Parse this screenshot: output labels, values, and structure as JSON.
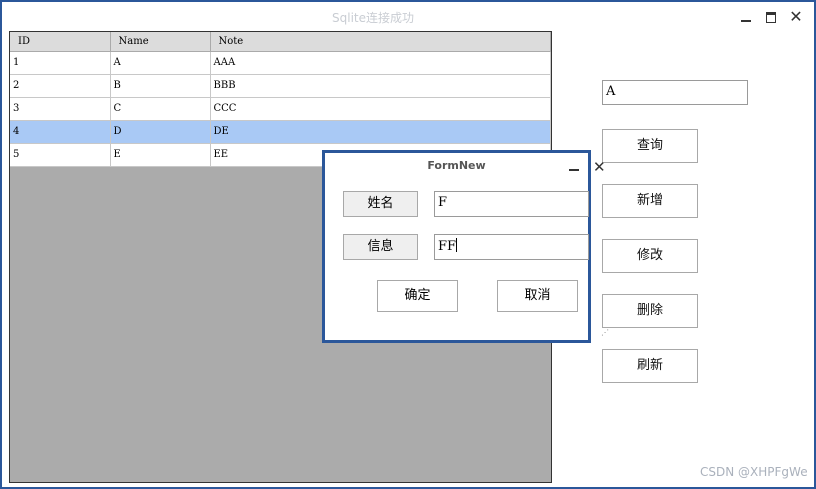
{
  "window": {
    "title": "Sqlite连接成功"
  },
  "grid": {
    "columns": [
      "ID",
      "Name",
      "Note"
    ],
    "rows": [
      [
        "1",
        "A",
        "AAA"
      ],
      [
        "2",
        "B",
        "BBB"
      ],
      [
        "3",
        "C",
        "CCC"
      ],
      [
        "4",
        "D",
        "DE"
      ],
      [
        "5",
        "E",
        "EE"
      ]
    ],
    "selected_row": 4,
    "selected_color": "#a9c9f5"
  },
  "side": {
    "search_value": "A",
    "buttons": [
      "查询",
      "新增",
      "修改",
      "删除",
      "刷新"
    ]
  },
  "dialog": {
    "title": "FormNew",
    "name_label": "姓名",
    "name_value": "F",
    "info_label": "信息",
    "info_value": "FF",
    "ok_label": "确定",
    "cancel_label": "取消"
  },
  "watermark": "CSDN @XHPFgWe",
  "accent_color": "#2b579a"
}
